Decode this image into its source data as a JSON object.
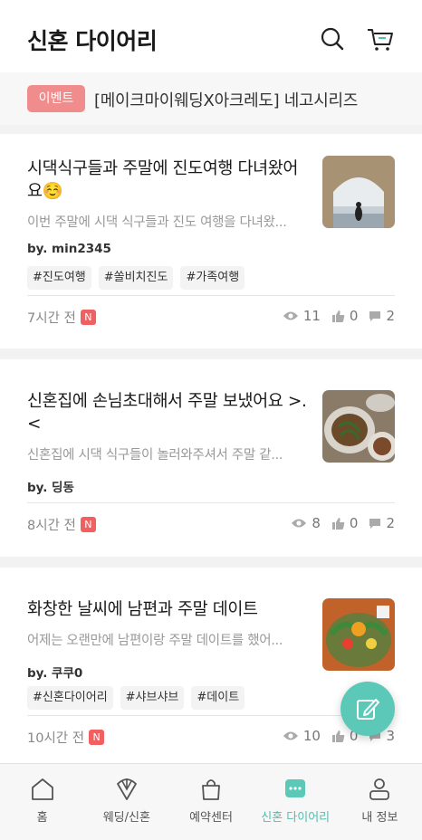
{
  "header": {
    "title": "신혼 다이어리",
    "search_icon": "search-icon",
    "cart_icon": "cart-icon"
  },
  "event": {
    "badge": "이벤트",
    "text": "[메이크마이웨딩X아크레도] 네고시리즈"
  },
  "posts": [
    {
      "title": "시댁식구들과 주말에 진도여행 다녀왔어요☺️",
      "preview": "이번 주말에 시댁 식구들과 진도 여행을 다녀왔...",
      "author": "by. min2345",
      "tags": [
        "#진도여행",
        "#쏠비치진도",
        "#가족여행"
      ],
      "time": "7시간 전",
      "new": "N",
      "views": "11",
      "likes": "0",
      "comments": "2"
    },
    {
      "title": "신혼집에 손님초대해서 주말 보냈어요 >.<",
      "preview": "신혼집에 시댁 식구들이 놀러와주셔서 주말 같...",
      "author": "by. 딩동",
      "tags": [],
      "time": "8시간 전",
      "new": "N",
      "views": "8",
      "likes": "0",
      "comments": "2"
    },
    {
      "title": "화창한 날씨에 남편과 주말 데이트",
      "preview": "어제는 오랜만에 남편이랑 주말 데이트를 했어...",
      "author": "by. 쿠쿠0",
      "tags": [
        "#신혼다이어리",
        "#샤브샤브",
        "#데이트"
      ],
      "time": "10시간 전",
      "new": "N",
      "views": "10",
      "likes": "0",
      "comments": "3"
    }
  ],
  "tabs": [
    {
      "label": "홈",
      "icon": "home-icon"
    },
    {
      "label": "웨딩/신혼",
      "icon": "bouquet-icon"
    },
    {
      "label": "예약센터",
      "icon": "shopping-bag-icon"
    },
    {
      "label": "신혼 다이어리",
      "icon": "chat-icon",
      "active": true
    },
    {
      "label": "내 정보",
      "icon": "person-icon"
    }
  ],
  "colors": {
    "accent": "#5cc8b8",
    "event_badge": "#f08c8c",
    "new_badge": "#f06060"
  }
}
